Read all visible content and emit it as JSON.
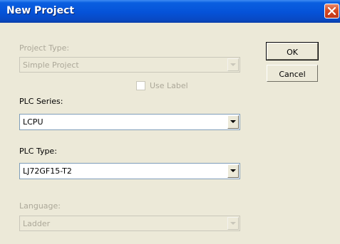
{
  "dialog": {
    "title": "New Project"
  },
  "buttons": {
    "ok_label": "OK",
    "cancel_label": "Cancel"
  },
  "fields": {
    "project_type": {
      "label": "Project Type:",
      "value": "Simple Project",
      "enabled": false
    },
    "use_label": {
      "label": "Use Label",
      "checked": false,
      "enabled": false
    },
    "plc_series": {
      "label": "PLC Series:",
      "value": "LCPU",
      "enabled": true
    },
    "plc_type": {
      "label": "PLC Type:",
      "value": "LJ72GF15-T2",
      "enabled": true
    },
    "language": {
      "label": "Language:",
      "value": "Ladder",
      "enabled": false
    }
  },
  "icons": {
    "close": "close-icon",
    "dropdown": "chevron-down-icon"
  },
  "colors": {
    "titlebar": "#0552d8",
    "close_button": "#d64a22",
    "window_bg": "#ece9d8",
    "disabled_text": "#aca899"
  }
}
